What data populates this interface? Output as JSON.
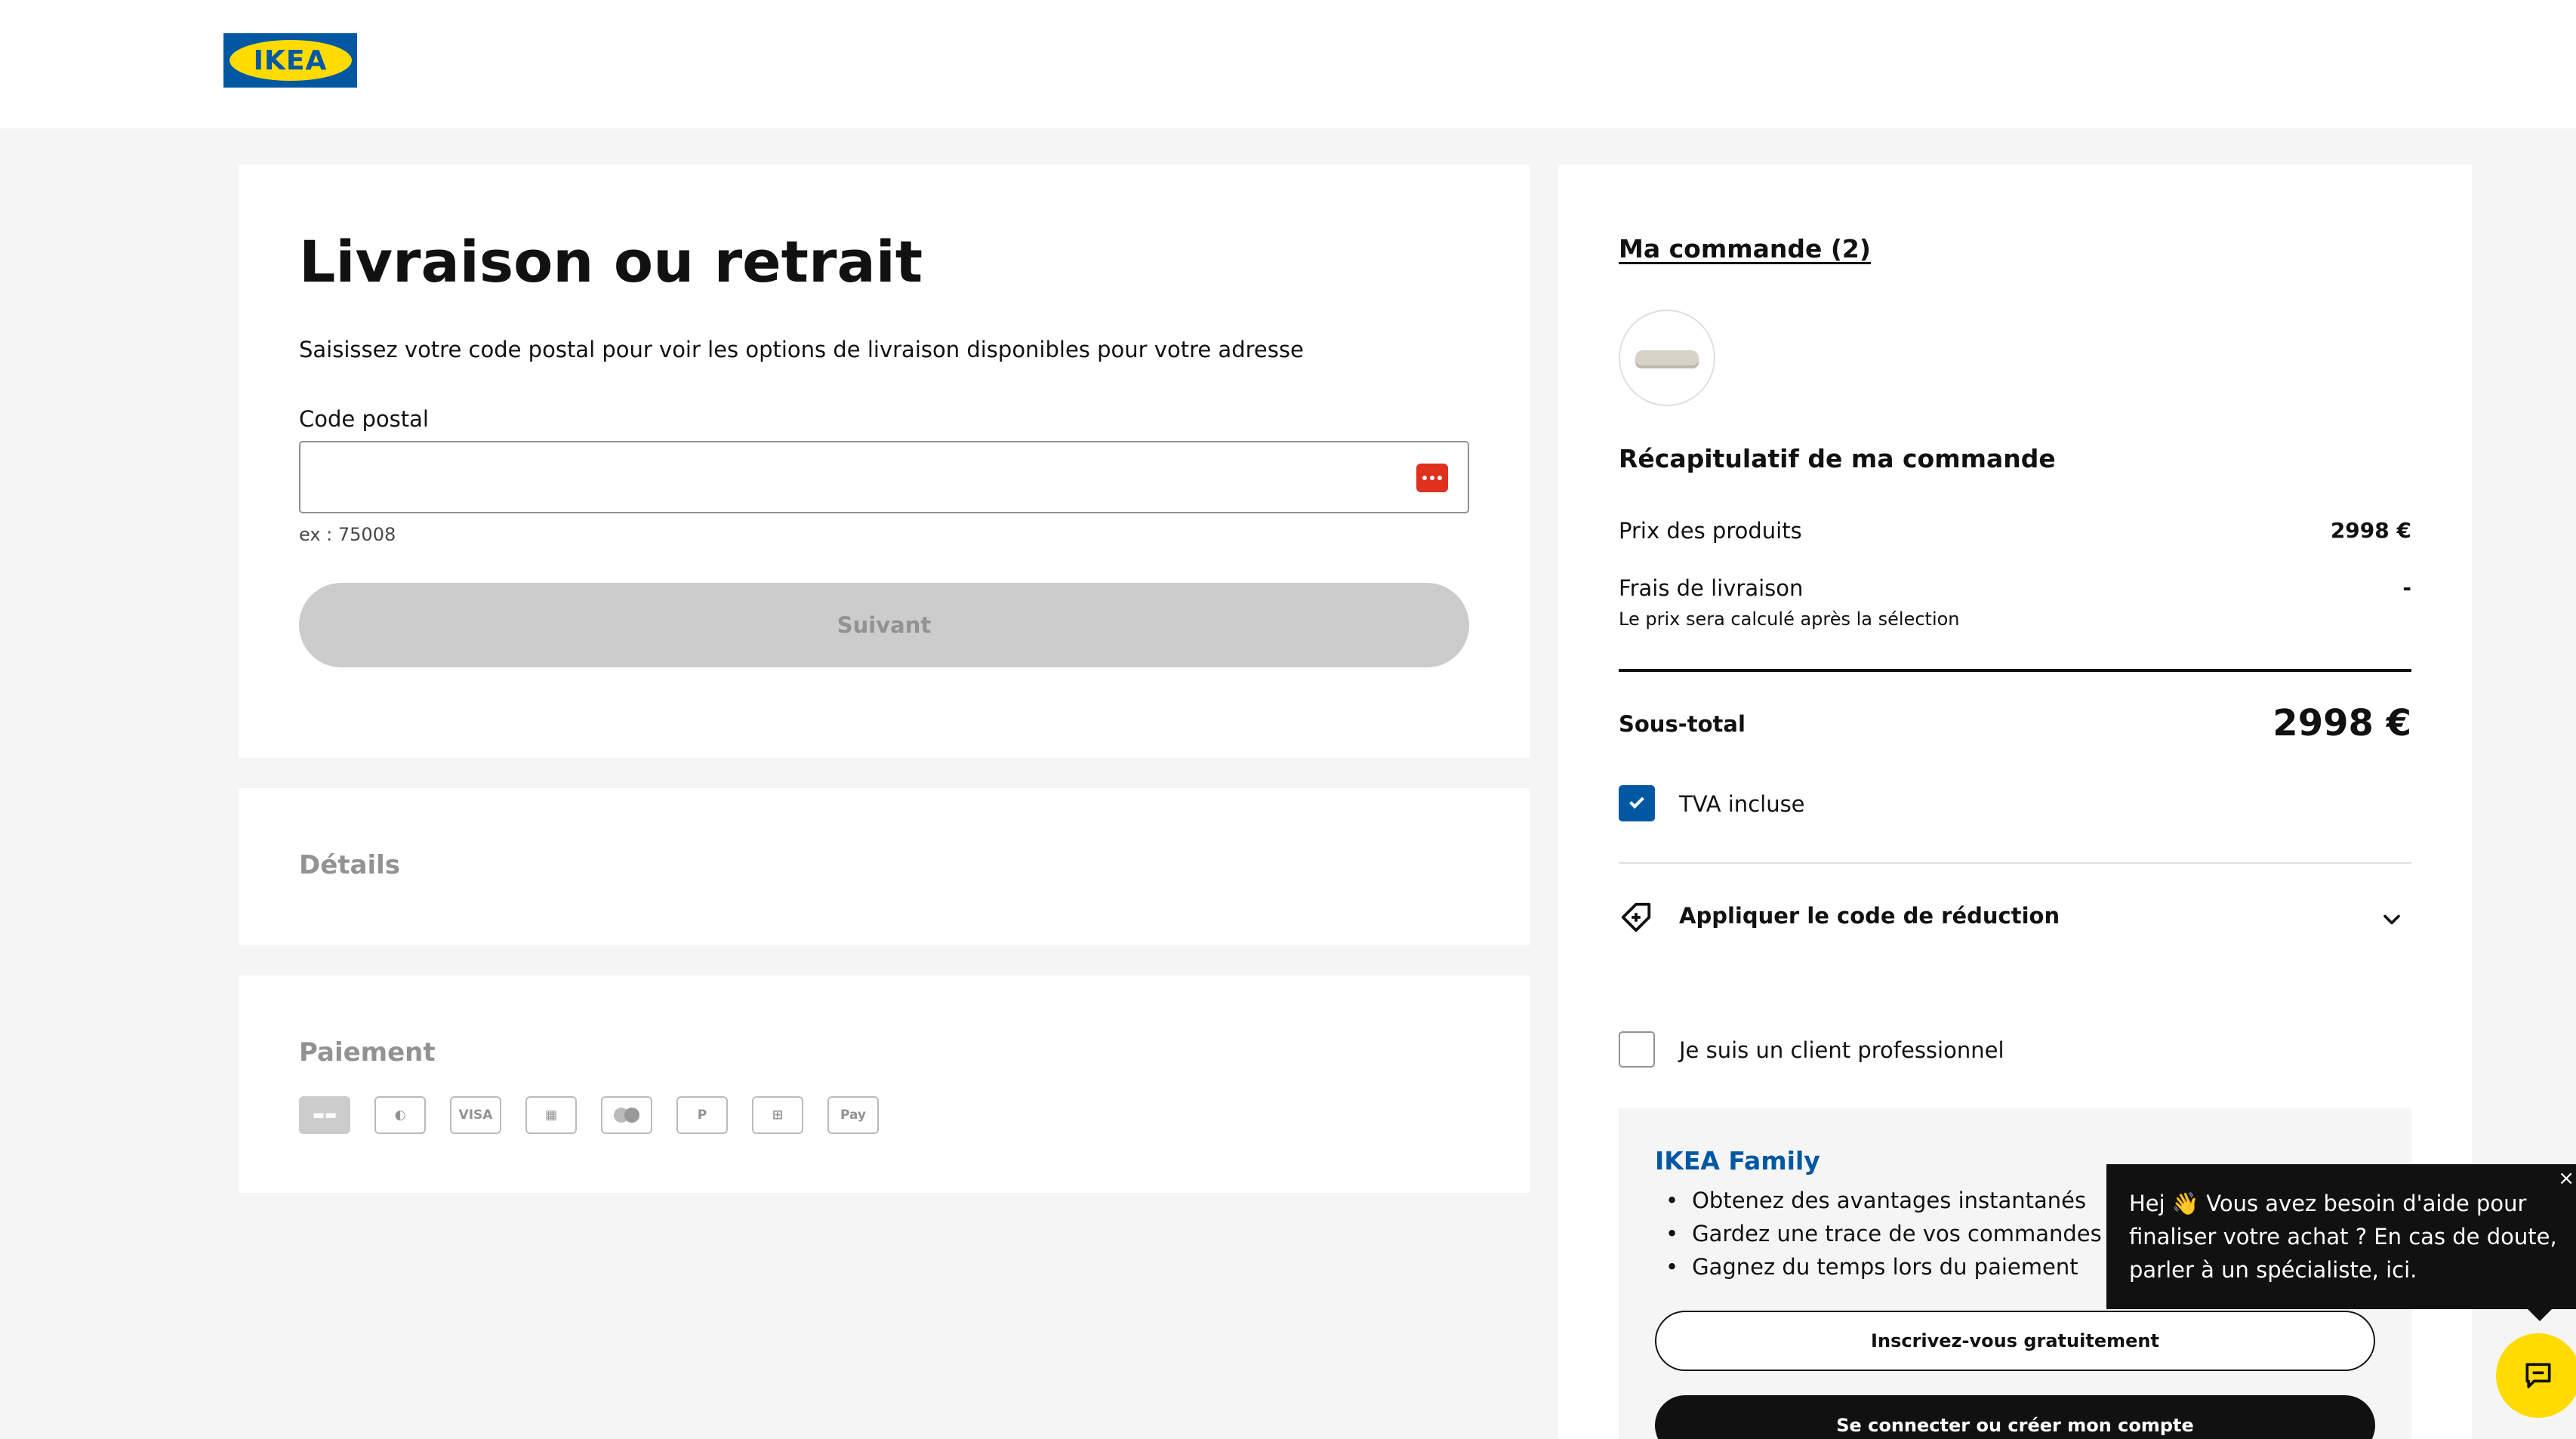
{
  "header": {
    "logo_text": "IKEA"
  },
  "delivery": {
    "title": "Livraison ou retrait",
    "intro": "Saisissez votre code postal pour voir les options de livraison disponibles pour votre adresse",
    "postal_label": "Code postal",
    "postal_value": "",
    "postal_hint": "ex : 75008",
    "next_label": "Suivant"
  },
  "details": {
    "title": "Détails"
  },
  "payment": {
    "title": "Paiement",
    "methods": [
      "card",
      "meal-voucher",
      "VISA",
      "AMEX",
      "mastercard",
      "PayPal",
      "gift-card",
      "Pay"
    ]
  },
  "summary": {
    "order_link": "Ma commande (2)",
    "title": "Récapitulatif de ma commande",
    "products_label": "Prix des produits",
    "products_value": "2998 €",
    "shipping_label": "Frais de livraison",
    "shipping_value": "-",
    "shipping_note": "Le prix sera calculé après la sélection",
    "subtotal_label": "Sous-total",
    "subtotal_value": "2998 €",
    "vat_label": "TVA incluse",
    "vat_checked": true,
    "discount_label": "Appliquer le code de réduction",
    "pro_label": "Je suis un client professionnel",
    "pro_checked": false
  },
  "family": {
    "title": "IKEA Family",
    "benefits": [
      "Obtenez des avantages instantanés",
      "Gardez une trace de vos commandes",
      "Gagnez du temps lors du paiement"
    ],
    "signup_label": "Inscrivez-vous gratuitement",
    "login_label": "Se connecter ou créer mon compte"
  },
  "chat": {
    "message": "Hej 👋 Vous avez besoin d'aide pour finaliser votre achat ? En cas de doute, parler à un spécialiste, ici.",
    "close_label": "×"
  },
  "colors": {
    "ikea_blue": "#0058a3",
    "ikea_yellow": "#ffdb00",
    "disabled_button": "#cccccc",
    "background": "#f5f5f5"
  }
}
